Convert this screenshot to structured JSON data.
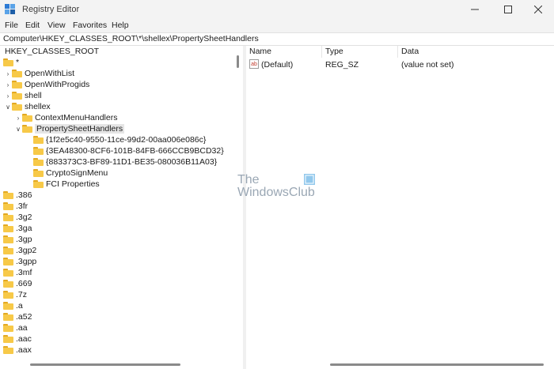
{
  "window": {
    "title": "Registry Editor"
  },
  "menu": [
    "File",
    "Edit",
    "View",
    "Favorites",
    "Help"
  ],
  "address": "Computer\\HKEY_CLASSES_ROOT\\*\\shellex\\PropertySheetHandlers",
  "tree": {
    "root": "HKEY_CLASSES_ROOT",
    "items": [
      {
        "label": "*",
        "expanded": true
      },
      {
        "label": "OpenWithList",
        "expanded": false
      },
      {
        "label": "OpenWithProgids",
        "expanded": false
      },
      {
        "label": "shell",
        "expanded": false
      },
      {
        "label": "shellex",
        "expanded": true
      },
      {
        "label": "ContextMenuHandlers",
        "expanded": false
      },
      {
        "label": "PropertySheetHandlers",
        "expanded": true,
        "selected": true
      },
      {
        "label": "{1f2e5c40-9550-11ce-99d2-00aa006e086c}"
      },
      {
        "label": "{3EA48300-8CF6-101B-84FB-666CCB9BCD32}"
      },
      {
        "label": "{883373C3-BF89-11D1-BE35-080036B11A03}"
      },
      {
        "label": "CryptoSignMenu"
      },
      {
        "label": "FCI Properties"
      },
      {
        "label": ".386"
      },
      {
        "label": ".3fr"
      },
      {
        "label": ".3g2"
      },
      {
        "label": ".3ga"
      },
      {
        "label": ".3gp"
      },
      {
        "label": ".3gp2"
      },
      {
        "label": ".3gpp"
      },
      {
        "label": ".3mf"
      },
      {
        "label": ".669"
      },
      {
        "label": ".7z"
      },
      {
        "label": ".a"
      },
      {
        "label": ".a52"
      },
      {
        "label": ".aa"
      },
      {
        "label": ".aac"
      },
      {
        "label": ".aax"
      }
    ]
  },
  "list": {
    "columns": [
      "Name",
      "Type",
      "Data"
    ],
    "rows": [
      {
        "name": "(Default)",
        "type": "REG_SZ",
        "data": "(value not set)"
      }
    ]
  },
  "watermark": {
    "line1": "The",
    "line2": "WindowsClub"
  }
}
